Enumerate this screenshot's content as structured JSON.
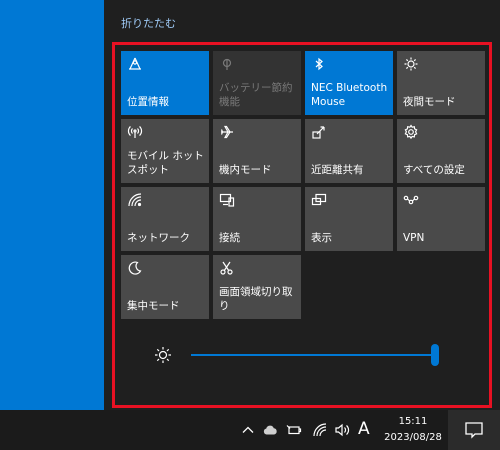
{
  "action_center": {
    "collapse_label": "折りたたむ",
    "tiles": [
      {
        "label": "位置情報",
        "icon": "location-icon",
        "state": "on"
      },
      {
        "label": "バッテリー節約機能",
        "icon": "battery-saver-icon",
        "state": "disabled"
      },
      {
        "label": "NEC Bluetooth Mouse",
        "icon": "bluetooth-icon",
        "state": "on"
      },
      {
        "label": "夜間モード",
        "icon": "night-light-icon",
        "state": "off"
      },
      {
        "label": "モバイル ホットスポット",
        "icon": "mobile-hotspot-icon",
        "state": "off"
      },
      {
        "label": "機内モード",
        "icon": "airplane-icon",
        "state": "off"
      },
      {
        "label": "近距離共有",
        "icon": "nearby-share-icon",
        "state": "off"
      },
      {
        "label": "すべての設定",
        "icon": "settings-gear-icon",
        "state": "off"
      },
      {
        "label": "ネットワーク",
        "icon": "network-icon",
        "state": "off"
      },
      {
        "label": "接続",
        "icon": "connect-icon",
        "state": "off"
      },
      {
        "label": "表示",
        "icon": "project-icon",
        "state": "off"
      },
      {
        "label": "VPN",
        "icon": "vpn-icon",
        "state": "off"
      },
      {
        "label": "集中モード",
        "icon": "moon-icon",
        "state": "off"
      },
      {
        "label": "画面領域切り取り",
        "icon": "snip-icon",
        "state": "off"
      }
    ],
    "brightness": {
      "icon": "brightness-sun-icon",
      "level_percent": 100
    }
  },
  "taskbar": {
    "tray_icons": [
      "chevron-up-icon",
      "onedrive-cloud-icon",
      "battery-icon",
      "wifi-icon",
      "volume-icon"
    ],
    "ime_mode": "A",
    "time": "15:11",
    "date": "2023/08/28",
    "notification_icon": "notification-icon"
  },
  "colors": {
    "accent": "#0078d4",
    "tile_off": "#4a4a4a",
    "tile_disabled": "#333333",
    "highlight_border": "#e81123",
    "panel_bg": "#1f1f1f",
    "link": "#9ec9f5"
  }
}
